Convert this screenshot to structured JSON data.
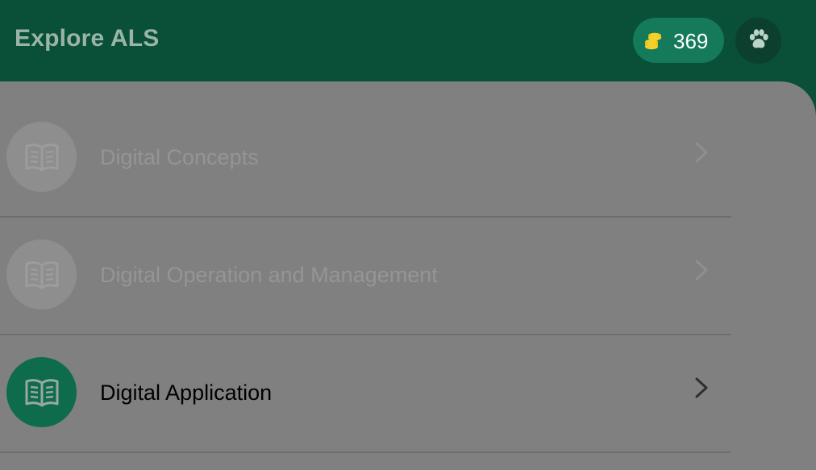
{
  "header": {
    "title": "Explore ALS",
    "coins": "369",
    "coin_icon": "coin-stack-icon",
    "paw_icon": "paw-icon"
  },
  "colors": {
    "header_bg": "#0a4f38",
    "pill_bg": "#147a5a",
    "active_circle": "#0e6b4c",
    "overlay": "#808080",
    "coin_gold": "#f3d12b"
  },
  "modules": [
    {
      "label": "Digital Concepts",
      "enabled": false,
      "icon": "open-book-icon"
    },
    {
      "label": "Digital Operation and Management",
      "enabled": false,
      "icon": "open-book-icon"
    },
    {
      "label": "Digital Application",
      "enabled": true,
      "icon": "open-book-icon"
    }
  ]
}
